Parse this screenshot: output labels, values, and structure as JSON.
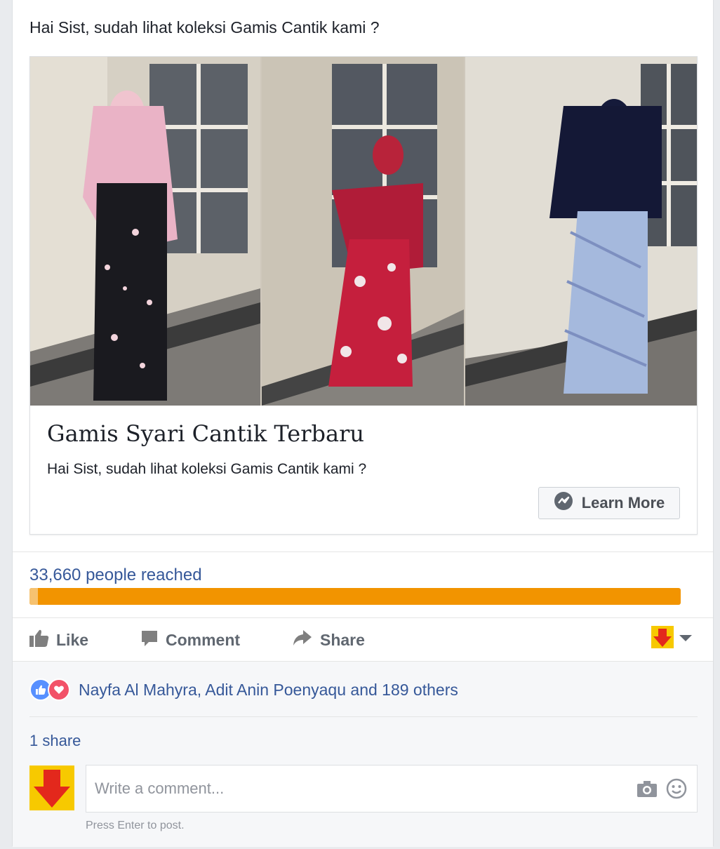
{
  "post": {
    "text": "Hai Sist, sudah lihat koleksi Gamis Cantik kami ?"
  },
  "link": {
    "title": "Gamis Syari Cantik Terbaru",
    "description": "Hai Sist, sudah lihat koleksi Gamis Cantik kami ?",
    "cta_label": "Learn More",
    "cta_icon": "messenger-icon"
  },
  "reach": {
    "text": "33,660 people reached",
    "fraction": 1.0,
    "color": "#f29400"
  },
  "actions": {
    "like": "Like",
    "comment": "Comment",
    "share": "Share"
  },
  "reactions": {
    "names": "Nayfa Al Mahyra, Adit Anin Poenyaqu and 189 others",
    "types": [
      "like",
      "love"
    ]
  },
  "shares": "1 share",
  "comment": {
    "placeholder": "Write a comment...",
    "hint": "Press Enter to post.",
    "icons": [
      "camera-icon",
      "emoji-icon"
    ]
  },
  "colors": {
    "link": "#365899",
    "text": "#1d2129",
    "muted": "#606770"
  }
}
